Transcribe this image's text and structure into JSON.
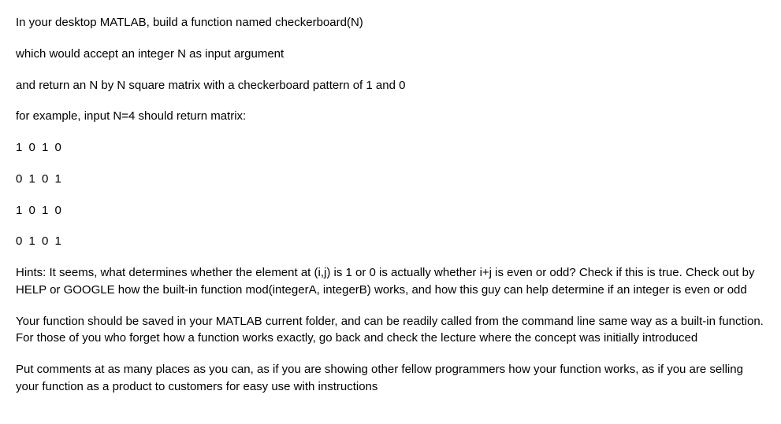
{
  "paragraphs": [
    "In your desktop MATLAB, build a function named checkerboard(N)",
    "which would accept an integer N as input argument",
    "and return an N by N square matrix with a checkerboard pattern of 1 and 0",
    "for example, input N=4 should return matrix:",
    "1 0 1 0",
    "0 1 0 1",
    "1 0 1 0",
    "0 1 0 1",
    "Hints: It seems, what determines whether the element at (i,j) is 1 or 0 is actually whether i+j is even or odd? Check if this is true. Check out by HELP or GOOGLE how the built-in function mod(integerA, integerB) works, and how this guy can help determine if an integer is even or odd",
    "Your function should be saved in your MATLAB current folder, and can be readily called from the command line same way as a built-in function. For those of you who forget how a function works exactly, go back and check the lecture where the concept was initially introduced",
    "Put comments at as many places as you can, as if you are showing other fellow programmers how your function works, as if you are selling your function as a product to customers for easy use with instructions"
  ]
}
